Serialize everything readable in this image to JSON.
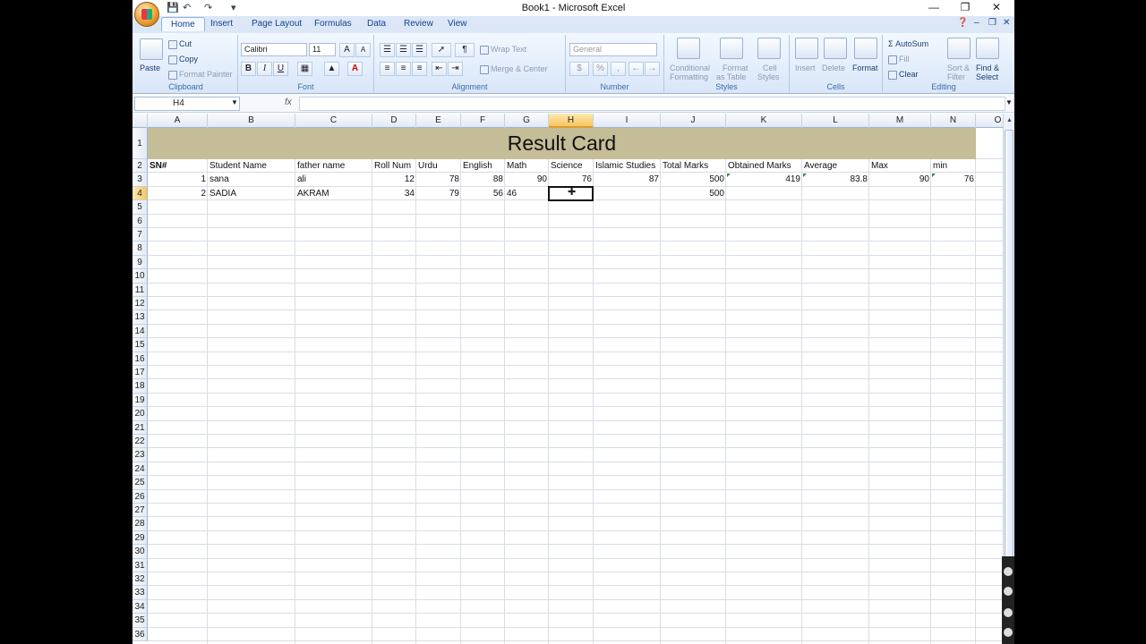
{
  "app": {
    "title": "Book1 - Microsoft Excel"
  },
  "tabs": [
    "Home",
    "Insert",
    "Page Layout",
    "Formulas",
    "Data",
    "Review",
    "View"
  ],
  "ribbon": {
    "clipboard": {
      "title": "Clipboard",
      "paste": "Paste",
      "cut": "Cut",
      "copy": "Copy",
      "format_painter": "Format Painter"
    },
    "font": {
      "title": "Font",
      "name": "Calibri",
      "size": "11",
      "bold": "B",
      "italic": "I",
      "underline": "U",
      "grow": "A",
      "shrink": "A",
      "color_letter": "A"
    },
    "alignment": {
      "title": "Alignment",
      "wrap": "Wrap Text",
      "merge": "Merge & Center"
    },
    "number": {
      "title": "Number",
      "format": "General",
      "currency": "$",
      "percent": "%",
      "comma": ","
    },
    "styles": {
      "title": "Styles",
      "conditional_1": "Conditional",
      "conditional_2": "Formatting",
      "table_1": "Format",
      "table_2": "as Table",
      "cell_1": "Cell",
      "cell_2": "Styles"
    },
    "cells": {
      "title": "Cells",
      "insert": "Insert",
      "delete": "Delete",
      "format": "Format"
    },
    "editing": {
      "title": "Editing",
      "autosum": "AutoSum",
      "fill": "Fill",
      "clear": "Clear",
      "sort_1": "Sort &",
      "sort_2": "Filter",
      "find_1": "Find &",
      "find_2": "Select"
    }
  },
  "formula_bar": {
    "name_box": "H4",
    "fx": "fx",
    "value": ""
  },
  "columns": [
    "A",
    "B",
    "C",
    "D",
    "E",
    "F",
    "G",
    "H",
    "I",
    "J",
    "K",
    "L",
    "M",
    "N",
    "O"
  ],
  "rows": [
    "1",
    "2",
    "3",
    "4",
    "5",
    "6",
    "7",
    "8",
    "9",
    "10",
    "11",
    "12",
    "13",
    "14",
    "15",
    "16",
    "17",
    "18",
    "19",
    "20",
    "21",
    "22",
    "23",
    "24",
    "25",
    "26",
    "27",
    "28",
    "29",
    "30",
    "31",
    "32",
    "33",
    "34",
    "35",
    "36"
  ],
  "sheet": {
    "banner": "Result Card",
    "headers": [
      "SN#",
      "Student Name",
      "father name",
      "Roll Num",
      "Urdu",
      "English",
      "Math",
      "Science",
      "Islamic Studies",
      "Total Marks",
      "Obtained  Marks",
      "Average",
      "Max",
      "min"
    ],
    "row3": [
      "1",
      "sana",
      "ali",
      "12",
      "78",
      "88",
      "90",
      "76",
      "87",
      "500",
      "419",
      "83.8",
      "90",
      "76"
    ],
    "row4": [
      "2",
      "SADIA",
      "AKRAM",
      "34",
      "79",
      "56",
      "46",
      "",
      "",
      "500",
      "",
      "",
      "",
      ""
    ]
  },
  "selected_cell": "H4"
}
